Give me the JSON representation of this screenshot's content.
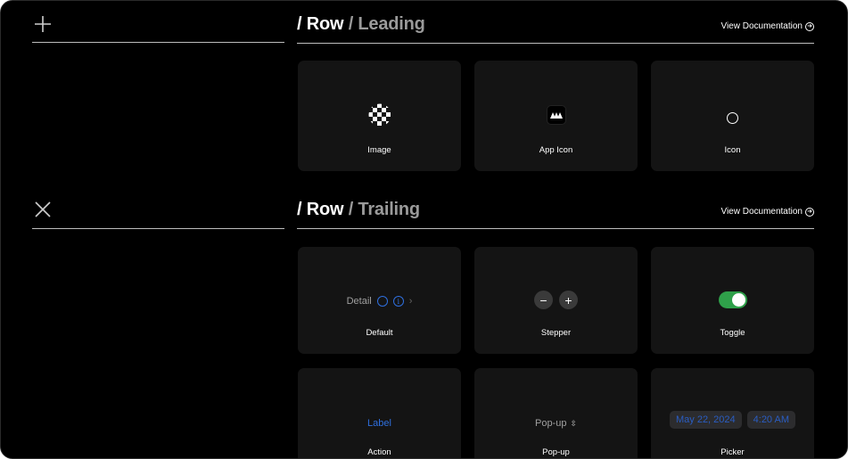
{
  "sidebar": {
    "add_icon": "plus-icon",
    "close_icon": "close-icon"
  },
  "sections": {
    "leading": {
      "title_lead": "/ Row",
      "title_sub": "/ Leading",
      "doc_link": "View Documentation",
      "cards": {
        "image": "Image",
        "app_icon": "App Icon",
        "icon": "Icon"
      }
    },
    "trailing": {
      "title_lead": "/ Row",
      "title_sub": "/ Trailing",
      "doc_link": "View Documentation",
      "cards": {
        "default": {
          "label": "Default",
          "detail_text": "Detail"
        },
        "stepper": {
          "label": "Stepper",
          "minus": "−",
          "plus": "+"
        },
        "toggle": {
          "label": "Toggle",
          "state": "on"
        },
        "action": {
          "label": "Action",
          "action_text": "Label"
        },
        "popup": {
          "label": "Pop-up",
          "value": "Pop-up"
        },
        "picker": {
          "label": "Picker",
          "date": "May 22, 2024",
          "time": "4:20 AM"
        }
      }
    }
  },
  "colors": {
    "background": "#000000",
    "card": "#141414",
    "accent_blue": "#2f6fde",
    "toggle_green": "#2fa04a",
    "muted_text": "#9a9a9a"
  }
}
